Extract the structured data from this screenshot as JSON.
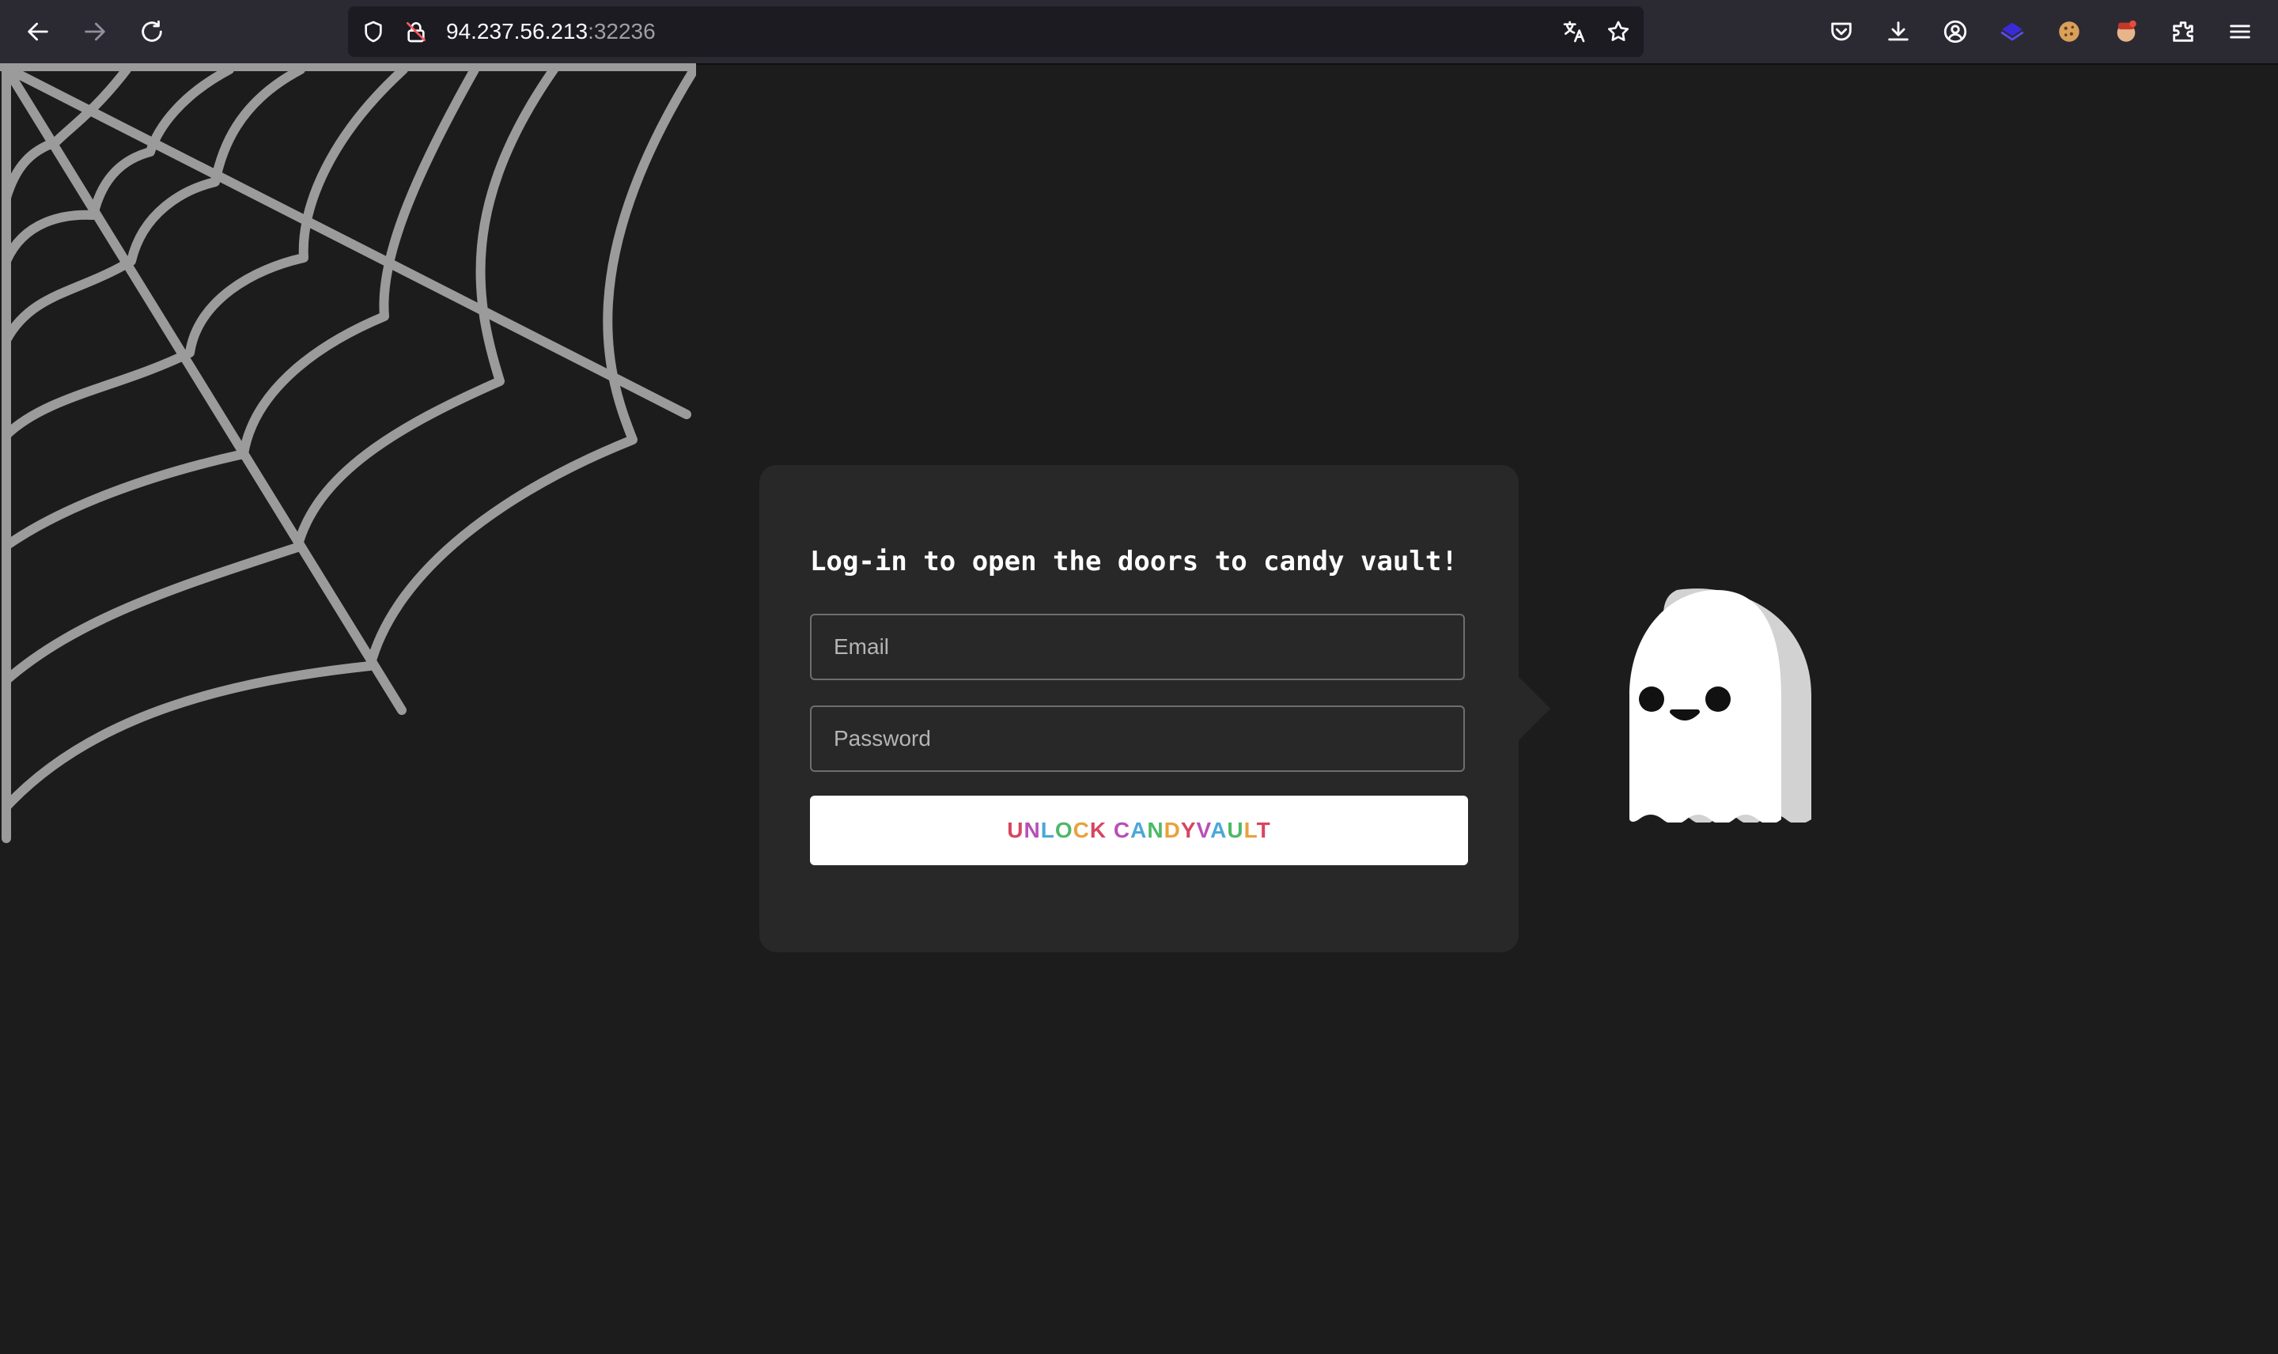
{
  "browser": {
    "url_host": "94.237.56.213",
    "url_port": ":32236"
  },
  "login": {
    "title": "Log-in to open the doors to candy vault!",
    "email_placeholder": "Email",
    "password_placeholder": "Password",
    "button_label": "UNLOCK CANDYVAULT",
    "button_colors": [
      "#d8455f",
      "#b84fb8",
      "#4aa8d8",
      "#4fb86a",
      "#e8a23c",
      "#d8455f",
      "#b84fb8",
      "#4aa8d8",
      "#4fb86a",
      "#e8a23c",
      "#d8455f",
      "#b84fb8",
      "#4aa8d8",
      "#4fb86a",
      "#e8a23c",
      "#d8455f",
      "#b84fb8"
    ]
  },
  "colors": {
    "page_background": "#1c1c1c",
    "card_background": "#282828",
    "web_stroke": "#9b9b9b",
    "ghost_body": "#ffffff",
    "ghost_shadow": "#d2d2d2"
  }
}
